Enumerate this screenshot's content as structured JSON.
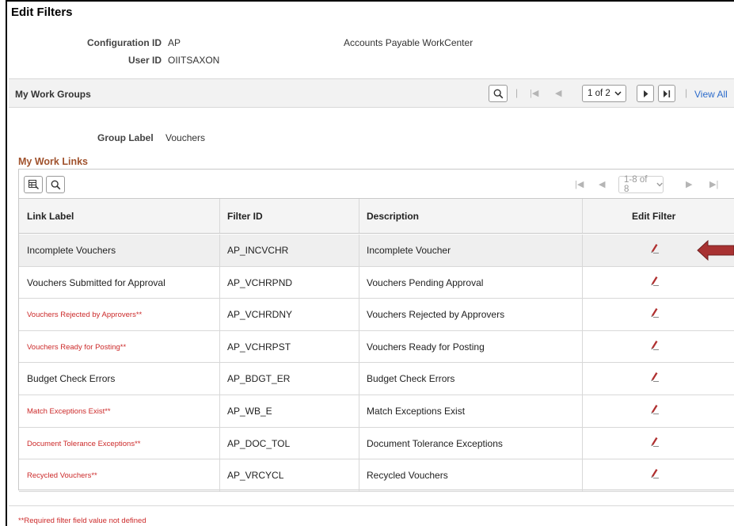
{
  "page": {
    "title": "Edit Filters"
  },
  "info": {
    "config_label": "Configuration ID",
    "config_value": "AP",
    "config_desc": "Accounts Payable WorkCenter",
    "user_label": "User ID",
    "user_value": "OIITSAXON"
  },
  "work_groups": {
    "title": "My Work Groups",
    "pager_select": "1 of 2",
    "view_all": "View All"
  },
  "group": {
    "label": "Group Label",
    "value": "Vouchers"
  },
  "work_links": {
    "title": "My Work Links",
    "pager_select": "1-8 of 8",
    "columns": [
      "Link Label",
      "Filter ID",
      "Description",
      "Edit Filter"
    ],
    "rows": [
      {
        "label": "Incomplete Vouchers",
        "filter_id": "AP_INCVCHR",
        "description": "Incomplete Voucher",
        "required": false
      },
      {
        "label": "Vouchers Submitted for Approval",
        "filter_id": "AP_VCHRPND",
        "description": "Vouchers Pending Approval",
        "required": false
      },
      {
        "label": "Vouchers Rejected by Approvers**",
        "filter_id": "AP_VCHRDNY",
        "description": "Vouchers Rejected by Approvers",
        "required": true
      },
      {
        "label": "Vouchers Ready for Posting**",
        "filter_id": "AP_VCHRPST",
        "description": "Vouchers Ready for Posting",
        "required": true
      },
      {
        "label": "Budget Check Errors",
        "filter_id": "AP_BDGT_ER",
        "description": "Budget Check Errors",
        "required": false
      },
      {
        "label": "Match Exceptions Exist**",
        "filter_id": "AP_WB_E",
        "description": "Match Exceptions Exist",
        "required": true
      },
      {
        "label": "Document Tolerance Exceptions**",
        "filter_id": "AP_DOC_TOL",
        "description": "Document Tolerance Exceptions",
        "required": true
      },
      {
        "label": "Recycled Vouchers**",
        "filter_id": "AP_VRCYCL",
        "description": "Recycled Vouchers",
        "required": true
      }
    ]
  },
  "footnote": "**Required filter field value not defined",
  "colors": {
    "required_text": "#cc2a2a",
    "section_title": "#a0522d",
    "link": "#2d6ccb",
    "annotation_arrow": "#a83232"
  },
  "icons": [
    "search-icon",
    "first-page-icon",
    "previous-page-icon",
    "next-page-icon",
    "last-page-icon",
    "personalize-grid-icon",
    "edit-pencil-icon",
    "annotation-arrow-icon"
  ]
}
